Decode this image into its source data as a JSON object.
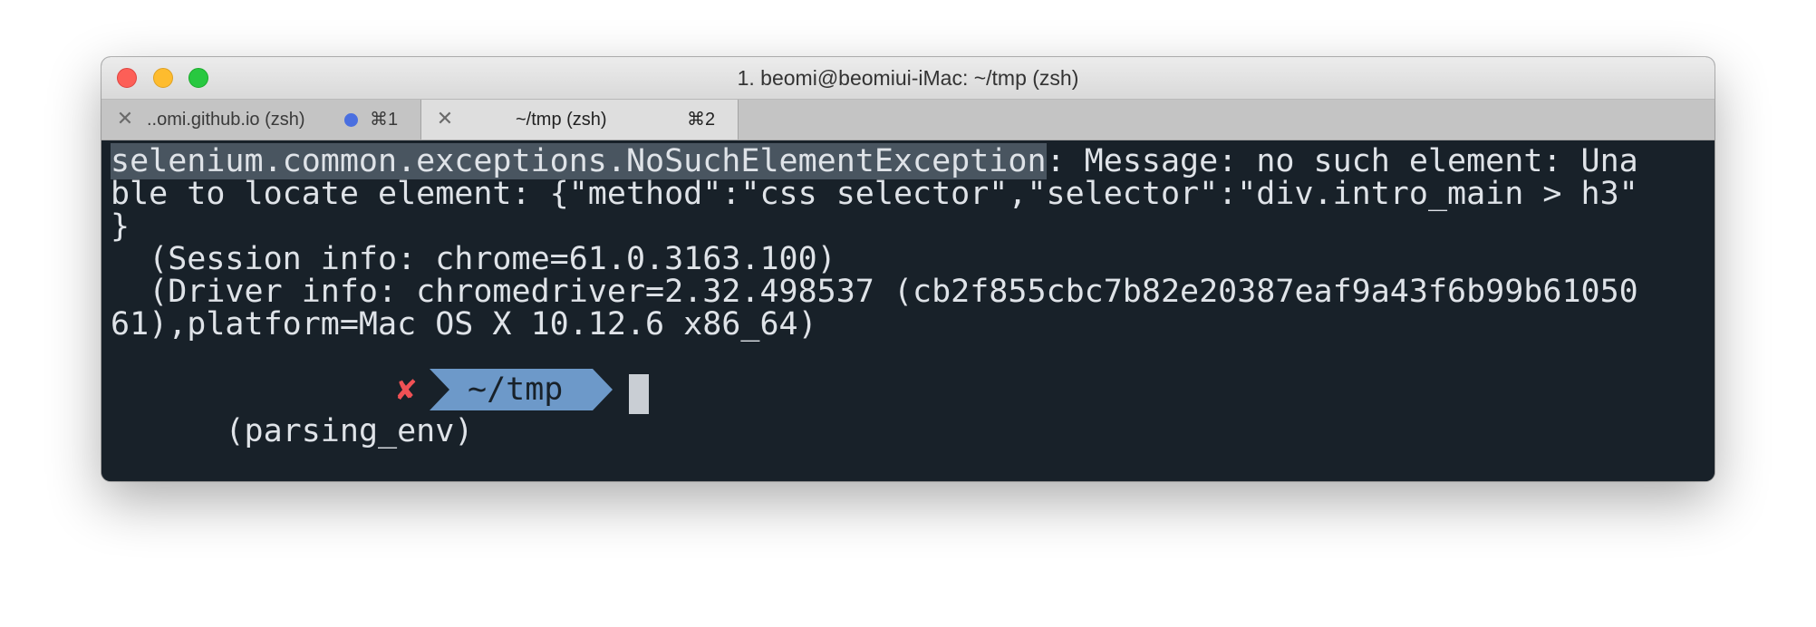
{
  "window": {
    "title": "1. beomi@beomiui-iMac: ~/tmp (zsh)"
  },
  "tabs": [
    {
      "label": "..omi.github.io (zsh)",
      "shortcut": "⌘1",
      "active": false,
      "dot_color": "#4a6fe0"
    },
    {
      "label": "~/tmp (zsh)",
      "shortcut": "⌘2",
      "active": true
    }
  ],
  "terminal": {
    "lines": [
      {
        "highlighted": "selenium.common.exceptions.NoSuchElementException",
        "rest": ": Message: no such element: Una"
      },
      {
        "text": "ble to locate element: {\"method\":\"css selector\",\"selector\":\"div.intro_main > h3\""
      },
      {
        "text": "}"
      },
      {
        "text": "  (Session info: chrome=61.0.3163.100)"
      },
      {
        "text": "  (Driver info: chromedriver=2.32.498537 (cb2f855cbc7b82e20387eaf9a43f6b99b61050"
      },
      {
        "text": "61),platform=Mac OS X 10.12.6 x86_64)"
      }
    ],
    "prompt": {
      "env": "(parsing_env)",
      "status_symbol": "✘",
      "dir": "~/tmp",
      "segment_color": "#6d99c9",
      "error_color": "#f05155"
    }
  }
}
